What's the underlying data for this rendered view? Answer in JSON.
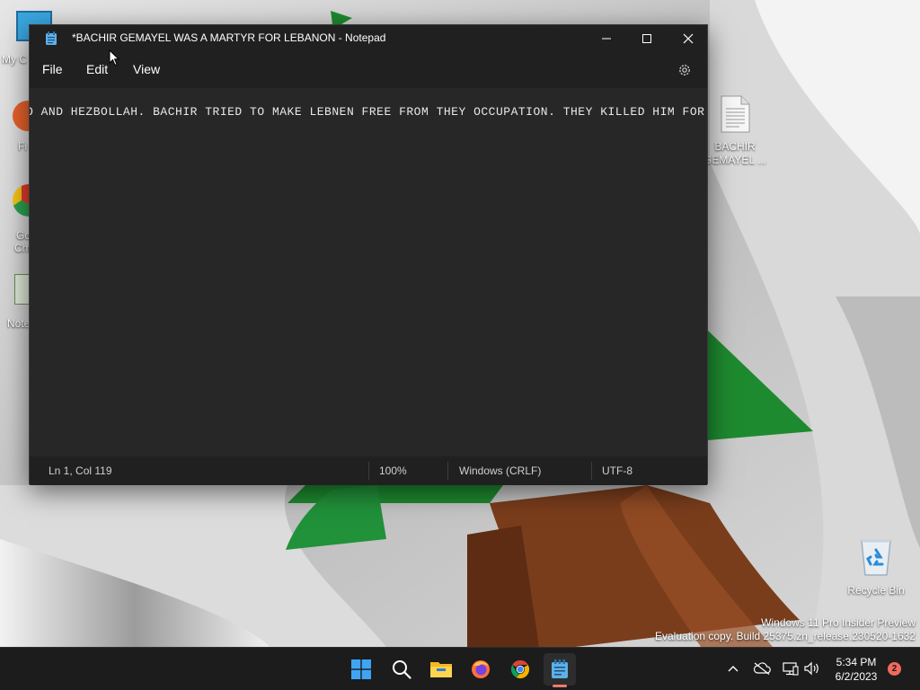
{
  "desktop": {
    "left_icons": [
      {
        "label": "My C"
      },
      {
        "label": "Fi"
      },
      {
        "label": "Go"
      },
      {
        "label": "Chr"
      },
      {
        "label": "Note"
      }
    ],
    "file_icon": {
      "line1": "BACHIR",
      "line2": "GEMAYEL ..."
    },
    "recycle_bin": {
      "label": "Recycle Bin"
    },
    "watermark": {
      "line1": "Windows 11 Pro Insider Preview",
      "line2": "Evaluation copy. Build 25375.zn_release.230520-1632"
    }
  },
  "notepad": {
    "title": "*BACHIR GEMAYEL WAS A MARTYR FOR LEBANON - Notepad",
    "menu": {
      "file": "File",
      "edit": "Edit",
      "view": "View"
    },
    "editor_text": "O AND HEZBOLLAH. BACHIR TRIED TO MAKE LEBNEN FREE FROM THEY OCCUPATION. THEY KILLED HIM FOR IT.",
    "status": {
      "position": "Ln 1, Col 119",
      "zoom": "100%",
      "line_ending": "Windows (CRLF)",
      "encoding": "UTF-8"
    }
  },
  "taskbar": {
    "apps": [
      {
        "icon": "windows-start-icon"
      },
      {
        "icon": "search-icon"
      },
      {
        "icon": "file-explorer-icon"
      },
      {
        "icon": "firefox-icon"
      },
      {
        "icon": "chrome-icon"
      },
      {
        "icon": "notepad-icon",
        "active": true
      }
    ],
    "clock": {
      "time": "5:34 PM",
      "date": "6/2/2023"
    },
    "notifications": "2"
  },
  "colors": {
    "flag_green": "#1e8a2f",
    "cedar_brown": "#7a3d1c",
    "window_bg": "#272727",
    "titlebar_bg": "#202020",
    "taskbar_bg": "#1c1c1c",
    "accent": "#f07c6e"
  }
}
